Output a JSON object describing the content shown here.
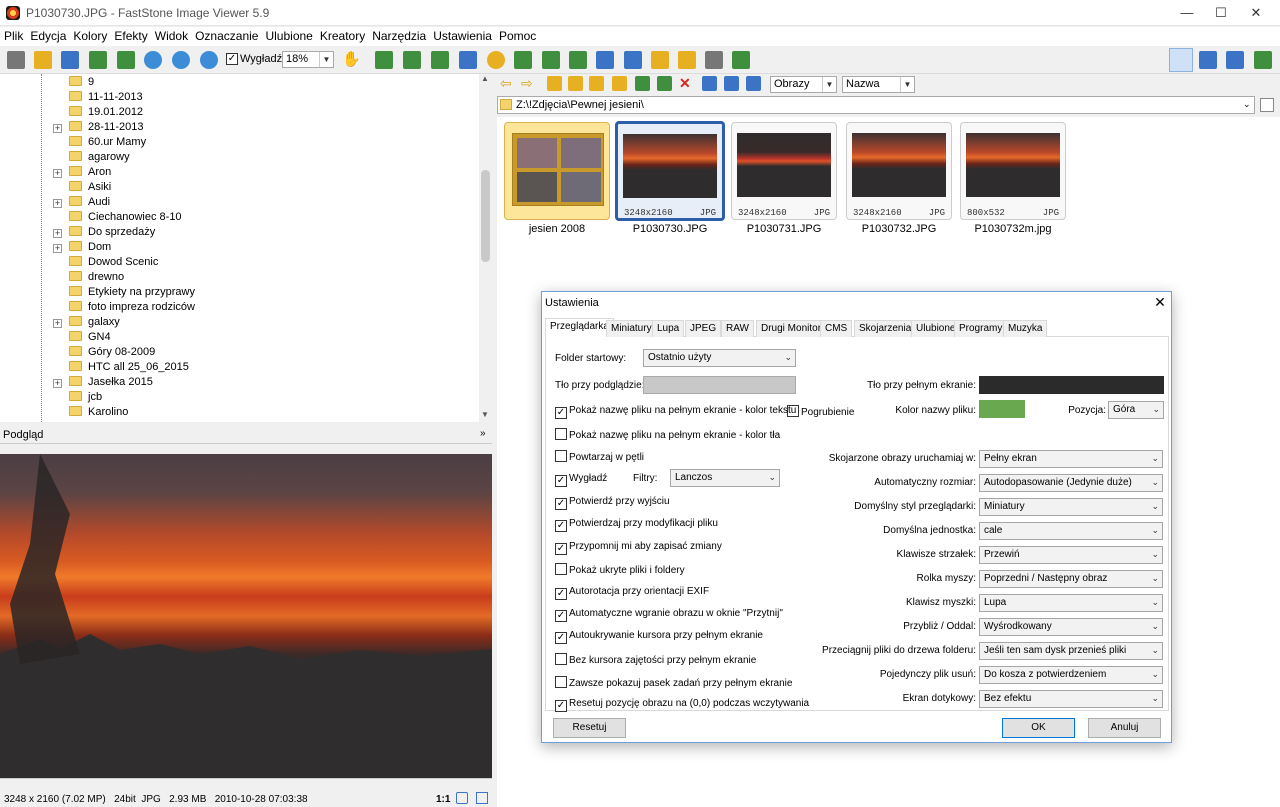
{
  "window": {
    "title": "P1030730.JPG  -  FastStone Image Viewer 5.9"
  },
  "menu": [
    "Plik",
    "Edycja",
    "Kolory",
    "Efekty",
    "Widok",
    "Oznaczanie",
    "Ulubione",
    "Kreatory",
    "Narzędzia",
    "Ustawienia",
    "Pomoc"
  ],
  "toolbar": {
    "smooth_label": "Wygładź",
    "zoom": "18%"
  },
  "tree": {
    "items": [
      {
        "label": "9",
        "expandable": false
      },
      {
        "label": "11-11-2013",
        "expandable": false
      },
      {
        "label": "19.01.2012",
        "expandable": false
      },
      {
        "label": "28-11-2013",
        "expandable": true
      },
      {
        "label": "60.ur Mamy",
        "expandable": false
      },
      {
        "label": "agarowy",
        "expandable": false
      },
      {
        "label": "Aron",
        "expandable": true
      },
      {
        "label": "Asiki",
        "expandable": false
      },
      {
        "label": "Audi",
        "expandable": true
      },
      {
        "label": "Ciechanowiec 8-10",
        "expandable": false
      },
      {
        "label": "Do sprzedaży",
        "expandable": true
      },
      {
        "label": "Dom",
        "expandable": true
      },
      {
        "label": "Dowod Scenic",
        "expandable": false
      },
      {
        "label": "drewno",
        "expandable": false
      },
      {
        "label": "Etykiety na przyprawy",
        "expandable": false
      },
      {
        "label": "foto impreza rodziców",
        "expandable": false
      },
      {
        "label": "galaxy",
        "expandable": true
      },
      {
        "label": "GN4",
        "expandable": false
      },
      {
        "label": "Góry 08-2009",
        "expandable": false
      },
      {
        "label": "HTC all 25_06_2015",
        "expandable": false
      },
      {
        "label": "Jasełka 2015",
        "expandable": true
      },
      {
        "label": "jcb",
        "expandable": false
      },
      {
        "label": "Karolino",
        "expandable": false
      }
    ]
  },
  "preview": {
    "title": "Podgląd"
  },
  "status": {
    "dims": "3248 x 2160 (7.02 MP)",
    "bits": "24bit",
    "format": "JPG",
    "size": "2.93 MB",
    "date": "2010-10-28 07:03:38",
    "ratio": "1:1"
  },
  "browser": {
    "filter": "Obrazy",
    "sort": "Nazwa",
    "path": "Z:\\!Zdjęcia\\Pewnej jesieni\\"
  },
  "thumbnails": [
    {
      "name": "jesien 2008",
      "res": "",
      "ext": ""
    },
    {
      "name": "P1030730.JPG",
      "res": "3248x2160",
      "ext": "JPG"
    },
    {
      "name": "P1030731.JPG",
      "res": "3248x2160",
      "ext": "JPG"
    },
    {
      "name": "P1030732.JPG",
      "res": "3248x2160",
      "ext": "JPG"
    },
    {
      "name": "P1030732m.jpg",
      "res": "800x532",
      "ext": "JPG"
    }
  ],
  "dialog": {
    "title": "Ustawienia",
    "tabs": [
      "Przeglądarka",
      "Miniatury",
      "Lupa",
      "JPEG",
      "RAW",
      "Drugi Monitor",
      "CMS",
      "Skojarzenia",
      "Ulubione",
      "Programy",
      "Muzyka"
    ],
    "start_folder_label": "Folder startowy:",
    "start_folder_value": "Ostatnio użyty",
    "bg_preview_label": "Tło przy podglądzie:",
    "bg_full_label": "Tło przy pełnym ekranie:",
    "filters_label": "Filtry:",
    "filters_value": "Lanczos",
    "bold_label": "Pogrubienie",
    "name_color_label": "Kolor nazwy pliku:",
    "position_label": "Pozycja:",
    "position_value": "Góra",
    "colors": {
      "preview_bg": "#c8c8c8",
      "full_bg": "#2b2b2b",
      "name_color": "#6aa84f",
      "accent": "#0078d7"
    },
    "checkboxes": [
      {
        "label": "Pokaż nazwę pliku na pełnym ekranie - kolor tekstu",
        "checked": true
      },
      {
        "label": "Pokaż nazwę pliku na pełnym ekranie - kolor tła",
        "checked": false
      },
      {
        "label": "Powtarzaj w pętli",
        "checked": false
      },
      {
        "label": "Wygładź",
        "checked": true
      },
      {
        "label": "Potwierdź przy wyjściu",
        "checked": true
      },
      {
        "label": "Potwierdzaj przy modyfikacji pliku",
        "checked": true
      },
      {
        "label": "Przypomnij mi aby zapisać zmiany",
        "checked": true
      },
      {
        "label": "Pokaż ukryte pliki i foldery",
        "checked": false
      },
      {
        "label": "Autorotacja przy orientacji EXIF",
        "checked": true
      },
      {
        "label": "Automatyczne wgranie obrazu w oknie \"Przytnij\"",
        "checked": true
      },
      {
        "label": "Autoukrywanie kursora przy pełnym ekranie",
        "checked": true
      },
      {
        "label": "Bez kursora zajętości przy pełnym ekranie",
        "checked": false
      },
      {
        "label": "Zawsze pokazuj pasek zadań przy pełnym ekranie",
        "checked": false
      },
      {
        "label": "Resetuj pozycję obrazu na (0,0) podczas wczytywania",
        "checked": true
      }
    ],
    "settings": [
      {
        "label": "Skojarzone obrazy uruchamiaj w:",
        "value": "Pełny ekran"
      },
      {
        "label": "Automatyczny rozmiar:",
        "value": "Autodopasowanie (Jedynie duże)"
      },
      {
        "label": "Domyślny styl przeglądarki:",
        "value": "Miniatury"
      },
      {
        "label": "Domyślna jednostka:",
        "value": "cale"
      },
      {
        "label": "Klawisze strzałek:",
        "value": "Przewiń"
      },
      {
        "label": "Rolka myszy:",
        "value": "Poprzedni / Następny obraz"
      },
      {
        "label": "Klawisz myszki:",
        "value": "Lupa"
      },
      {
        "label": "Przybliż / Oddal:",
        "value": "Wyśrodkowany"
      },
      {
        "label": "Przeciągnij pliki do drzewa folderu:",
        "value": "Jeśli ten sam dysk przenieś pliki"
      },
      {
        "label": "Pojedynczy plik usuń:",
        "value": "Do kosza z potwierdzeniem"
      },
      {
        "label": "Ekran dotykowy:",
        "value": "Bez efektu"
      }
    ],
    "reset_label": "Resetuj",
    "ok_label": "OK",
    "cancel_label": "Anuluj"
  }
}
